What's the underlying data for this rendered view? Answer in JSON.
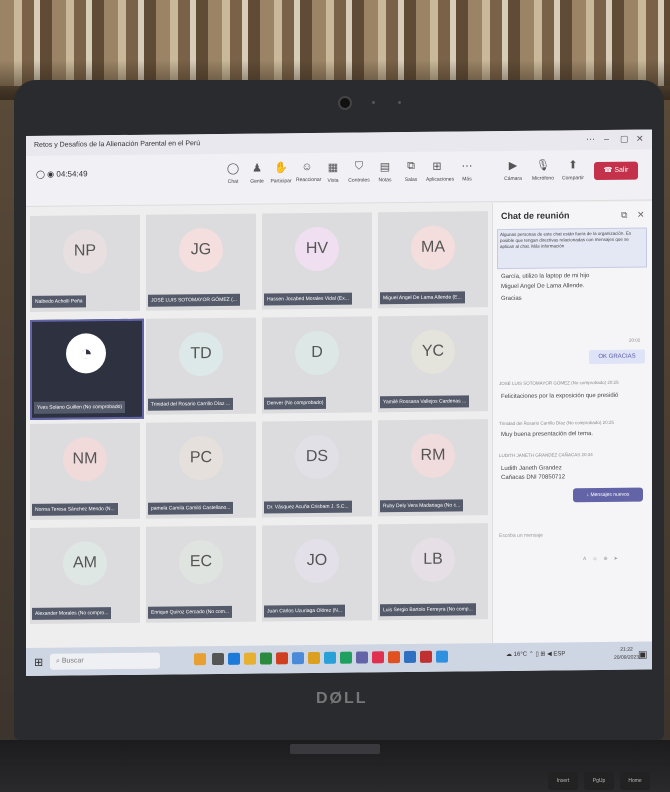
{
  "window": {
    "title": "Retos y Desafíos de la Alienación Parental en el Perú"
  },
  "meeting": {
    "timer": "04:54:49"
  },
  "toolbar": {
    "buttons": [
      "Chat",
      "Gente",
      "Participar",
      "Reaccionar",
      "Vista",
      "Controles",
      "Notas",
      "Salas",
      "Aplicaciones",
      "Más"
    ],
    "camera": "Cámara",
    "mic": "Micrófono",
    "share": "Compartir",
    "leave": "Salir"
  },
  "participants": [
    {
      "initials": "NP",
      "name": "Nalbedo Acholli Peña",
      "color": "#e8e0e0"
    },
    {
      "initials": "JG",
      "name": "JOSÉ LUIS SOTOMAYOR GÓMEZ (...",
      "color": "#f4dede"
    },
    {
      "initials": "HV",
      "name": "Hassen Jocabed Morales Vidal (Ex...",
      "color": "#f0dff0"
    },
    {
      "initials": "MA",
      "name": "Miguel Angel De Lama Allende (E...",
      "color": "#f4dedd"
    },
    {
      "initials": "",
      "name": "Yves Solano Guillen (No comprobado)",
      "obs": true
    },
    {
      "initials": "TD",
      "name": "Trinidad del Rosario Carrillo Díaz ...",
      "color": "#dde8e8"
    },
    {
      "initials": "D",
      "name": "Denver (No comprobado)",
      "color": "#dde8e6"
    },
    {
      "initials": "YC",
      "name": "Yamilé Rossana Vallejos Cardenas ...",
      "color": "#e4e4dc"
    },
    {
      "initials": "NM",
      "name": "Norma Teresa Sánchez Mendo (N...",
      "color": "#f0dada"
    },
    {
      "initials": "PC",
      "name": "pamela Camila Camiló Castellano...",
      "color": "#e6e0dc"
    },
    {
      "initials": "DS",
      "name": "Dr. Vásquez Acuña Crisbam J. S.C...",
      "color": "#e0e0e6"
    },
    {
      "initials": "RM",
      "name": "Ruby Dely Vera Madariaga (No c...",
      "color": "#f0dcdc"
    },
    {
      "initials": "AM",
      "name": "Alexander Morales (No compro...",
      "color": "#dfe7e4"
    },
    {
      "initials": "EC",
      "name": "Enrique Quiroz Cercado (No com...",
      "color": "#e0e4e0"
    },
    {
      "initials": "JO",
      "name": "Juan Carlos Uzuriaga Olórez (N...",
      "color": "#e3e0ea"
    },
    {
      "initials": "LB",
      "name": "Luis Sergio Bartolo Ferreyra (No comp...",
      "color": "#e6e0e6"
    }
  ],
  "chat": {
    "title": "Chat de reunión",
    "notice": "Algunas personas de este chat están fuera de la organización. Es posible que tengan directivas relacionadas con mensajes que se aplican al chat. Más información",
    "messages": [
      {
        "text": "García, utilizo la laptop de mi hijo"
      },
      {
        "text": "Miguel Angel De Lama Allende."
      },
      {
        "text": "Gracias"
      },
      {
        "meta": "20:02"
      },
      {
        "mine": "OK GRACIAS"
      },
      {
        "meta": "JOSÉ LUIS SOTOMAYOR GÓMEZ (No comprobado) 20:25"
      },
      {
        "text": "Felicitaciones por la exposición que presidió"
      },
      {
        "meta": "Trinidad del Rosario Carrillo Díaz (No comprobado) 20:25"
      },
      {
        "text": "Muy buena presentación del tema."
      },
      {
        "meta": "LUDITH JANETH GRANDEZ CAÑACAS 20:34"
      },
      {
        "text": "Ludith Janeth Grandez Cañacas DNI 70850712"
      }
    ],
    "new_messages": "Mensajes nuevos",
    "compose_placeholder": "Escriba un mensaje"
  },
  "taskbar": {
    "search_placeholder": "Buscar",
    "weather": "16°C",
    "time": "21:22",
    "date": "20/09/2023"
  },
  "brand": {
    "logo": "DØLL"
  },
  "keyboard": {
    "keys": [
      "Insert",
      "PgUp",
      "Home"
    ]
  }
}
